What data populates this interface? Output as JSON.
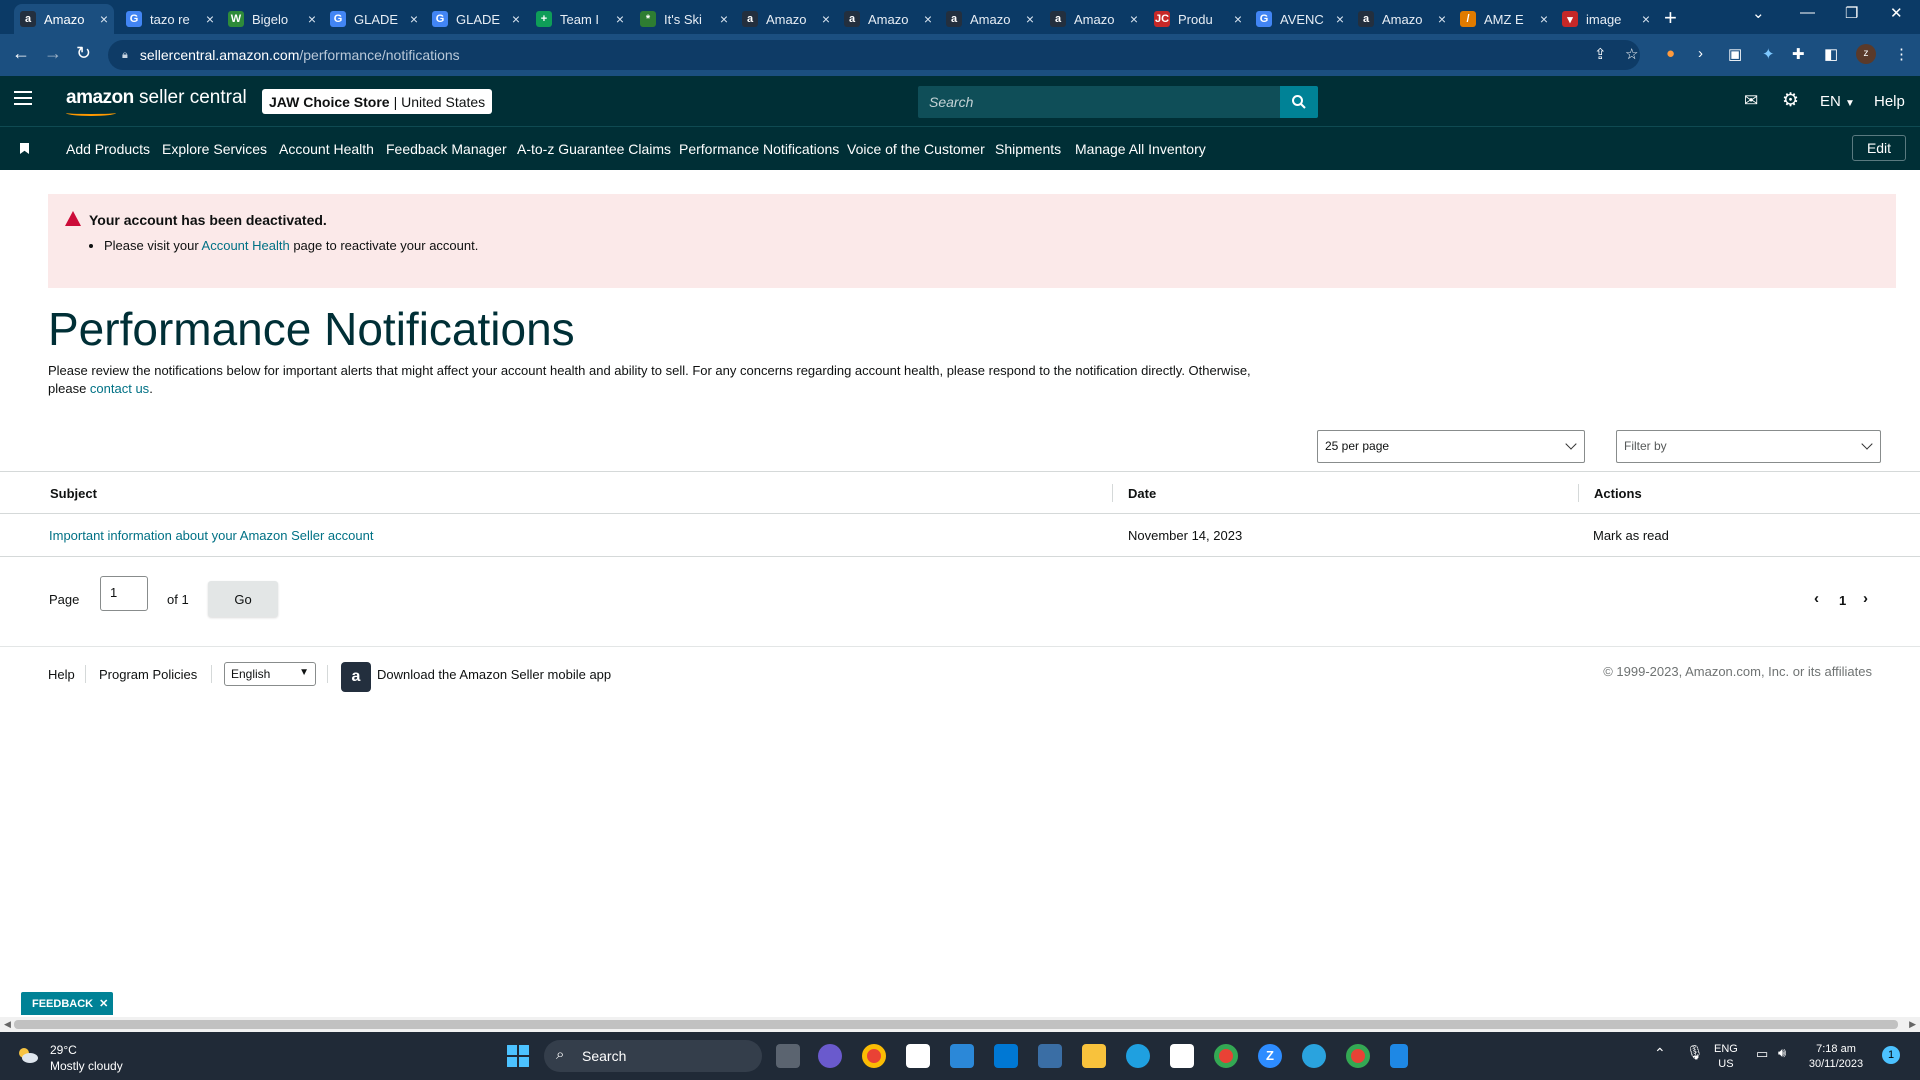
{
  "browser": {
    "tabs": [
      {
        "title": "Amazo",
        "icon": "amazon-icon",
        "color": "#232f3e",
        "glyph": "a"
      },
      {
        "title": "tazo re",
        "icon": "google-icon",
        "color": "#4285f4",
        "glyph": "G"
      },
      {
        "title": "Bigelo",
        "icon": "bigelow-icon",
        "color": "#2e8b3a",
        "glyph": "W"
      },
      {
        "title": "GLADE",
        "icon": "google-icon",
        "color": "#4285f4",
        "glyph": "G"
      },
      {
        "title": "GLADE",
        "icon": "google-icon",
        "color": "#4285f4",
        "glyph": "G"
      },
      {
        "title": "Team I",
        "icon": "sheets-icon",
        "color": "#0f9d58",
        "glyph": "+"
      },
      {
        "title": "It's Ski",
        "icon": "sparkle-icon",
        "color": "#2e7d32",
        "glyph": "*"
      },
      {
        "title": "Amazo",
        "icon": "amazon-icon",
        "color": "#232f3e",
        "glyph": "a"
      },
      {
        "title": "Amazo",
        "icon": "amazon-icon",
        "color": "#232f3e",
        "glyph": "a"
      },
      {
        "title": "Amazo",
        "icon": "amazon-icon",
        "color": "#232f3e",
        "glyph": "a"
      },
      {
        "title": "Amazo",
        "icon": "amazon-icon",
        "color": "#232f3e",
        "glyph": "a"
      },
      {
        "title": "Produ",
        "icon": "jungle-scout-icon",
        "color": "#c62828",
        "glyph": "JC"
      },
      {
        "title": "AVENC",
        "icon": "google-icon",
        "color": "#4285f4",
        "glyph": "G"
      },
      {
        "title": "Amazo",
        "icon": "amazon-icon",
        "color": "#232f3e",
        "glyph": "a"
      },
      {
        "title": "AMZ E",
        "icon": "amz-icon",
        "color": "#e07b00",
        "glyph": "/"
      },
      {
        "title": "image",
        "icon": "image-icon",
        "color": "#c62828",
        "glyph": "▾"
      }
    ],
    "url_host": "sellercentral.amazon.com",
    "url_path": "/performance/notifications"
  },
  "header": {
    "logo_bold": "amazon",
    "logo_rest": " seller central",
    "store_name": "JAW Choice Store",
    "store_region": "| United States",
    "search_placeholder": "Search",
    "language": "EN",
    "help": "Help"
  },
  "nav": {
    "items": [
      "Add Products",
      "Explore Services",
      "Account Health",
      "Feedback Manager",
      "A-to-z Guarantee Claims",
      "Performance Notifications",
      "Voice of the Customer",
      "Shipments",
      "Manage All Inventory"
    ],
    "edit": "Edit"
  },
  "alert": {
    "title": "Your account has been deactivated.",
    "pre": "Please visit your ",
    "link": "Account Health",
    "post": " page to reactivate your account."
  },
  "page": {
    "title": "Performance Notifications",
    "intro": "Please review the notifications below for important alerts that might affect your account health and ability to sell. For any concerns regarding account health, please respond to the notification directly. Otherwise, please ",
    "contact_link": "contact us",
    "intro_end": "."
  },
  "controls": {
    "per_page": "25 per page",
    "filter_placeholder": "Filter by"
  },
  "table": {
    "headers": [
      "Subject",
      "Date",
      "Actions"
    ],
    "rows": [
      {
        "subject": "Important information about your Amazon Seller account",
        "date": "November 14, 2023",
        "action": "Mark as read"
      }
    ]
  },
  "pagination": {
    "label": "Page",
    "value": "1",
    "of": "of 1",
    "go": "Go",
    "current": "1"
  },
  "footer": {
    "help": "Help",
    "policies": "Program Policies",
    "language": "English",
    "app_text": "Download the Amazon Seller mobile app",
    "copyright": "© 1999-2023, Amazon.com, Inc. or its affiliates"
  },
  "feedback": "FEEDBACK",
  "taskbar": {
    "temp": "29°C",
    "weather": "Mostly cloudy",
    "search": "Search",
    "lang1": "ENG",
    "lang2": "US",
    "time": "7:18 am",
    "date": "30/11/2023",
    "notifications": "1"
  },
  "colors": {
    "brand_dark": "#002f36",
    "link": "#007185",
    "alert_bg": "#fbe9e9",
    "warning": "#cc0c39",
    "search_button": "#008296"
  }
}
